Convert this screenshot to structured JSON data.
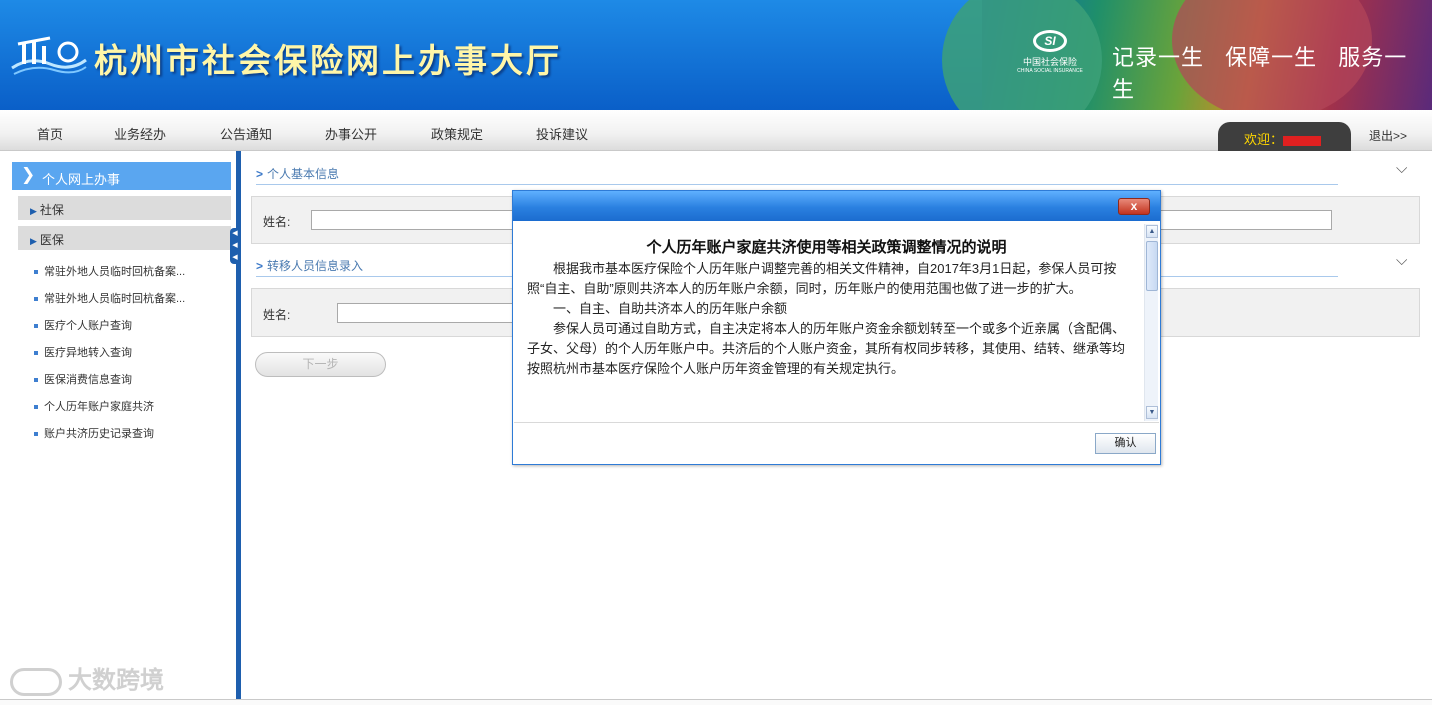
{
  "header": {
    "site_title": "杭州市社会保险网上办事大厅",
    "si_logo": {
      "mark": "SI",
      "cn": "中国社会保险",
      "en": "CHINA SOCIAL INSURANCE"
    },
    "slogans": [
      "记录一生",
      "保障一生",
      "服务一生"
    ]
  },
  "nav": {
    "items": [
      "首页",
      "业务经办",
      "公告通知",
      "办事公开",
      "政策规定",
      "投诉建议"
    ],
    "welcome_label": "欢迎：",
    "logout_label": "退出>>"
  },
  "sidebar": {
    "head": "个人网上办事",
    "groups": [
      "社保",
      "医保"
    ],
    "links": [
      "常驻外地人员临时回杭备案...",
      "常驻外地人员临时回杭备案...",
      "医疗个人账户查询",
      "医疗异地转入查询",
      "医保消费信息查询",
      "个人历年账户家庭共济",
      "账户共济历史记录查询"
    ]
  },
  "main": {
    "section1_title": "个人基本信息",
    "section1_name_label": "姓名:",
    "section2_title": "转移人员信息录入",
    "section2_name_label": "姓名:",
    "next_button": "下一步"
  },
  "modal": {
    "close_glyph": "x",
    "heading": "个人历年账户家庭共济使用等相关政策调整情况的说明",
    "paragraphs": [
      "根据我市基本医疗保险个人历年账户调整完善的相关文件精神，自2017年3月1日起，参保人员可按照“自主、自助”原则共济本人的历年账户余额，同时，历年账户的使用范围也做了进一步的扩大。",
      "一、自主、自助共济本人的历年账户余额",
      "参保人员可通过自助方式，自主决定将本人的历年账户资金余额划转至一个或多个近亲属（含配偶、子女、父母）的个人历年账户中。共济后的个人账户资金，其所有权同步转移，其使用、结转、继承等均按照杭州市基本医疗保险个人账户历年资金管理的有关规定执行。"
    ],
    "confirm_button": "确认"
  },
  "watermark": "大数跨境"
}
